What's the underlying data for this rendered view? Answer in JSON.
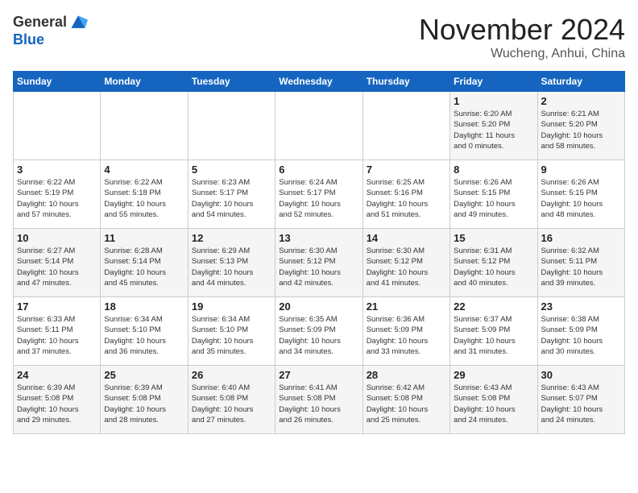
{
  "header": {
    "logo_general": "General",
    "logo_blue": "Blue",
    "month": "November 2024",
    "location": "Wucheng, Anhui, China"
  },
  "weekdays": [
    "Sunday",
    "Monday",
    "Tuesday",
    "Wednesday",
    "Thursday",
    "Friday",
    "Saturday"
  ],
  "weeks": [
    [
      {
        "day": "",
        "info": ""
      },
      {
        "day": "",
        "info": ""
      },
      {
        "day": "",
        "info": ""
      },
      {
        "day": "",
        "info": ""
      },
      {
        "day": "",
        "info": ""
      },
      {
        "day": "1",
        "info": "Sunrise: 6:20 AM\nSunset: 5:20 PM\nDaylight: 11 hours\nand 0 minutes."
      },
      {
        "day": "2",
        "info": "Sunrise: 6:21 AM\nSunset: 5:20 PM\nDaylight: 10 hours\nand 58 minutes."
      }
    ],
    [
      {
        "day": "3",
        "info": "Sunrise: 6:22 AM\nSunset: 5:19 PM\nDaylight: 10 hours\nand 57 minutes."
      },
      {
        "day": "4",
        "info": "Sunrise: 6:22 AM\nSunset: 5:18 PM\nDaylight: 10 hours\nand 55 minutes."
      },
      {
        "day": "5",
        "info": "Sunrise: 6:23 AM\nSunset: 5:17 PM\nDaylight: 10 hours\nand 54 minutes."
      },
      {
        "day": "6",
        "info": "Sunrise: 6:24 AM\nSunset: 5:17 PM\nDaylight: 10 hours\nand 52 minutes."
      },
      {
        "day": "7",
        "info": "Sunrise: 6:25 AM\nSunset: 5:16 PM\nDaylight: 10 hours\nand 51 minutes."
      },
      {
        "day": "8",
        "info": "Sunrise: 6:26 AM\nSunset: 5:15 PM\nDaylight: 10 hours\nand 49 minutes."
      },
      {
        "day": "9",
        "info": "Sunrise: 6:26 AM\nSunset: 5:15 PM\nDaylight: 10 hours\nand 48 minutes."
      }
    ],
    [
      {
        "day": "10",
        "info": "Sunrise: 6:27 AM\nSunset: 5:14 PM\nDaylight: 10 hours\nand 47 minutes."
      },
      {
        "day": "11",
        "info": "Sunrise: 6:28 AM\nSunset: 5:14 PM\nDaylight: 10 hours\nand 45 minutes."
      },
      {
        "day": "12",
        "info": "Sunrise: 6:29 AM\nSunset: 5:13 PM\nDaylight: 10 hours\nand 44 minutes."
      },
      {
        "day": "13",
        "info": "Sunrise: 6:30 AM\nSunset: 5:12 PM\nDaylight: 10 hours\nand 42 minutes."
      },
      {
        "day": "14",
        "info": "Sunrise: 6:30 AM\nSunset: 5:12 PM\nDaylight: 10 hours\nand 41 minutes."
      },
      {
        "day": "15",
        "info": "Sunrise: 6:31 AM\nSunset: 5:12 PM\nDaylight: 10 hours\nand 40 minutes."
      },
      {
        "day": "16",
        "info": "Sunrise: 6:32 AM\nSunset: 5:11 PM\nDaylight: 10 hours\nand 39 minutes."
      }
    ],
    [
      {
        "day": "17",
        "info": "Sunrise: 6:33 AM\nSunset: 5:11 PM\nDaylight: 10 hours\nand 37 minutes."
      },
      {
        "day": "18",
        "info": "Sunrise: 6:34 AM\nSunset: 5:10 PM\nDaylight: 10 hours\nand 36 minutes."
      },
      {
        "day": "19",
        "info": "Sunrise: 6:34 AM\nSunset: 5:10 PM\nDaylight: 10 hours\nand 35 minutes."
      },
      {
        "day": "20",
        "info": "Sunrise: 6:35 AM\nSunset: 5:09 PM\nDaylight: 10 hours\nand 34 minutes."
      },
      {
        "day": "21",
        "info": "Sunrise: 6:36 AM\nSunset: 5:09 PM\nDaylight: 10 hours\nand 33 minutes."
      },
      {
        "day": "22",
        "info": "Sunrise: 6:37 AM\nSunset: 5:09 PM\nDaylight: 10 hours\nand 31 minutes."
      },
      {
        "day": "23",
        "info": "Sunrise: 6:38 AM\nSunset: 5:09 PM\nDaylight: 10 hours\nand 30 minutes."
      }
    ],
    [
      {
        "day": "24",
        "info": "Sunrise: 6:39 AM\nSunset: 5:08 PM\nDaylight: 10 hours\nand 29 minutes."
      },
      {
        "day": "25",
        "info": "Sunrise: 6:39 AM\nSunset: 5:08 PM\nDaylight: 10 hours\nand 28 minutes."
      },
      {
        "day": "26",
        "info": "Sunrise: 6:40 AM\nSunset: 5:08 PM\nDaylight: 10 hours\nand 27 minutes."
      },
      {
        "day": "27",
        "info": "Sunrise: 6:41 AM\nSunset: 5:08 PM\nDaylight: 10 hours\nand 26 minutes."
      },
      {
        "day": "28",
        "info": "Sunrise: 6:42 AM\nSunset: 5:08 PM\nDaylight: 10 hours\nand 25 minutes."
      },
      {
        "day": "29",
        "info": "Sunrise: 6:43 AM\nSunset: 5:08 PM\nDaylight: 10 hours\nand 24 minutes."
      },
      {
        "day": "30",
        "info": "Sunrise: 6:43 AM\nSunset: 5:07 PM\nDaylight: 10 hours\nand 24 minutes."
      }
    ]
  ]
}
